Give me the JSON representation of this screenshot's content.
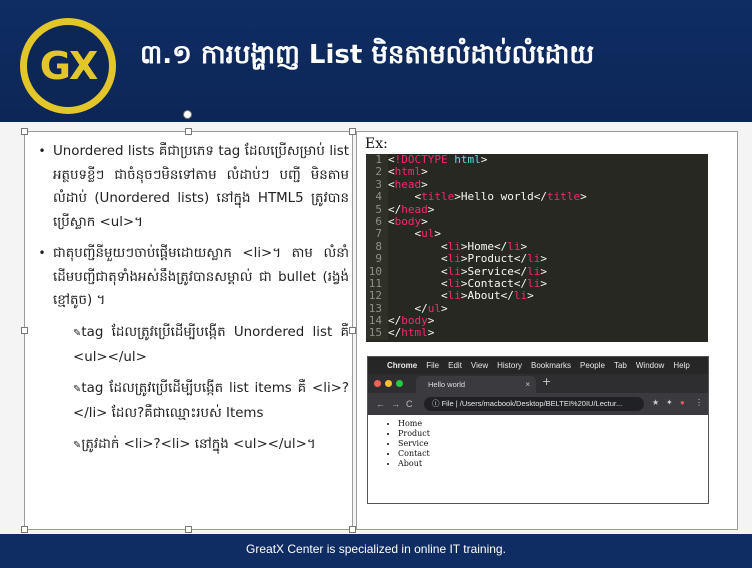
{
  "header": {
    "logo_text": "GX",
    "title": "៣.១ ការបង្ហាញ List មិនតាមលំដាប់លំដោយ"
  },
  "left_panel": {
    "bullets": [
      {
        "text": "Unordered lists គឺជាប្រភេទ tag ដែលប្រើសម្រាប់ list អត្ថបទខ្លីៗ ជាចំនុចៗមិនទៅតាម លំដាប់ៗ បញ្ជី មិនតាមលំដាប់ (Unordered lists) នៅក្នុង HTML5 ត្រូវបានប្រើស្លាក <ul>។"
      },
      {
        "text": "ជាតុបញ្ជីនីមួយៗចាប់ផ្ដើមដោយស្លាក <li>។ តាម លំនាំដើមបញ្ជីជាតុទាំងអស់នឹងត្រូវបានសម្គាល់ ជា bullet (រង្វង់ខ្មៅតូច) ។"
      }
    ],
    "sub_items": [
      {
        "text": "tag ដែលត្រូវប្រើដើម្បីបង្កើត Unordered list គឺ <ul></ul>"
      },
      {
        "text": "tag ដែលត្រូវប្រើដើម្បីបង្កើត list items គឺ <li>?</li> ដែល?គឺជាឈ្មោះរបស់ Items"
      },
      {
        "text": "ត្រូវដាក់ <li>?<li> នៅក្នុង <ul></ul>។"
      }
    ]
  },
  "right_panel": {
    "ex_label": "Ex:",
    "code_lines": [
      {
        "n": "1",
        "indent": "",
        "parts": [
          [
            "p",
            "<"
          ],
          [
            "t",
            "!DOCTYPE"
          ],
          [
            "p",
            " "
          ],
          [
            "k",
            "html"
          ],
          [
            "p",
            ">"
          ]
        ]
      },
      {
        "n": "2",
        "indent": "",
        "parts": [
          [
            "p",
            "<"
          ],
          [
            "t",
            "html"
          ],
          [
            "p",
            ">"
          ]
        ]
      },
      {
        "n": "3",
        "indent": "",
        "parts": [
          [
            "p",
            "<"
          ],
          [
            "t",
            "head"
          ],
          [
            "p",
            ">"
          ]
        ]
      },
      {
        "n": "4",
        "indent": "    ",
        "parts": [
          [
            "p",
            "<"
          ],
          [
            "t",
            "title"
          ],
          [
            "p",
            ">Hello world</"
          ],
          [
            "t",
            "title"
          ],
          [
            "p",
            ">"
          ]
        ]
      },
      {
        "n": "5",
        "indent": "",
        "parts": [
          [
            "p",
            "</"
          ],
          [
            "t",
            "head"
          ],
          [
            "p",
            ">"
          ]
        ]
      },
      {
        "n": "6",
        "indent": "",
        "parts": [
          [
            "p",
            "<"
          ],
          [
            "t",
            "body"
          ],
          [
            "p",
            ">"
          ]
        ]
      },
      {
        "n": "7",
        "indent": "    ",
        "parts": [
          [
            "p",
            "<"
          ],
          [
            "t",
            "ul"
          ],
          [
            "p",
            ">"
          ]
        ]
      },
      {
        "n": "8",
        "indent": "        ",
        "parts": [
          [
            "p",
            "<"
          ],
          [
            "t",
            "li"
          ],
          [
            "p",
            ">Home</"
          ],
          [
            "t",
            "li"
          ],
          [
            "p",
            ">"
          ]
        ]
      },
      {
        "n": "9",
        "indent": "        ",
        "parts": [
          [
            "p",
            "<"
          ],
          [
            "t",
            "li"
          ],
          [
            "p",
            ">Product</"
          ],
          [
            "t",
            "li"
          ],
          [
            "p",
            ">"
          ]
        ]
      },
      {
        "n": "10",
        "indent": "        ",
        "parts": [
          [
            "p",
            "<"
          ],
          [
            "t",
            "li"
          ],
          [
            "p",
            ">Service</"
          ],
          [
            "t",
            "li"
          ],
          [
            "p",
            ">"
          ]
        ]
      },
      {
        "n": "11",
        "indent": "        ",
        "parts": [
          [
            "p",
            "<"
          ],
          [
            "t",
            "li"
          ],
          [
            "p",
            ">Contact</"
          ],
          [
            "t",
            "li"
          ],
          [
            "p",
            ">"
          ]
        ]
      },
      {
        "n": "12",
        "indent": "        ",
        "parts": [
          [
            "p",
            "<"
          ],
          [
            "t",
            "li"
          ],
          [
            "p",
            ">About</"
          ],
          [
            "t",
            "li"
          ],
          [
            "p",
            ">"
          ]
        ]
      },
      {
        "n": "13",
        "indent": "    ",
        "parts": [
          [
            "p",
            "</"
          ],
          [
            "t",
            "ul"
          ],
          [
            "p",
            ">"
          ]
        ]
      },
      {
        "n": "14",
        "indent": "",
        "parts": [
          [
            "p",
            "</"
          ],
          [
            "t",
            "body"
          ],
          [
            "p",
            ">"
          ]
        ]
      },
      {
        "n": "15",
        "indent": "",
        "parts": [
          [
            "p",
            "</"
          ],
          [
            "t",
            "html"
          ],
          [
            "p",
            ">"
          ]
        ]
      }
    ],
    "browser": {
      "menu_apple": "",
      "menu_items": [
        "Chrome",
        "File",
        "Edit",
        "View",
        "History",
        "Bookmarks",
        "People",
        "Tab",
        "Window",
        "Help"
      ],
      "tab_title": "Hello world",
      "tab_close": "×",
      "new_tab": "+",
      "nav_back": "←",
      "nav_forward": "→",
      "nav_reload": "C",
      "url": "ⓘ  File  |  /Users/macbook/Desktop/BELTEI%20IU/Lectur...",
      "list_items": [
        "Home",
        "Product",
        "Service",
        "Contact",
        "About"
      ]
    }
  },
  "footer": {
    "text": "GreatX Center is specialized in online IT training."
  },
  "colors": {
    "navy": "#0f2d63",
    "gold": "#e3c62a",
    "code_bg": "#272822"
  }
}
